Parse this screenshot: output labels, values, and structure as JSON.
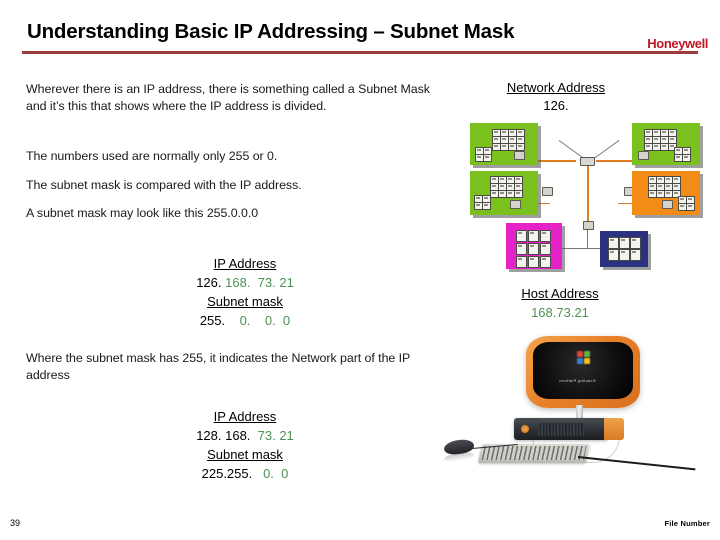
{
  "slide": {
    "title": "Understanding Basic IP Addressing – Subnet Mask",
    "brand": "Honeywell",
    "slide_number": "39",
    "file_number": "File Number",
    "accent_rule_color": "#9e3b3b",
    "brand_color": "#c01826",
    "host_text_color": "#4f9153"
  },
  "body": {
    "paragraph_1": "Wherever there is an IP address, there is something called a Subnet Mask and it’s this that shows where the IP address is divided.",
    "paragraph_2": "The numbers used are normally only 255 or 0.",
    "paragraph_3": "The subnet mask is compared with the IP address.",
    "paragraph_4": "A subnet mask may look like this 255.0.0.0",
    "paragraph_5": "Where the subnet mask has 255, it indicates the Network part of the IP address"
  },
  "ip_block_1": {
    "ip_label": "IP Address",
    "ip_network_part": "126.",
    "ip_host_part": " 168.  73. 21",
    "mask_label": "Subnet mask",
    "mask_network_part": "255.",
    "mask_host_part": "    0.    0.  0"
  },
  "ip_block_2": {
    "ip_label": "IP Address",
    "ip_network_part": "128. 168.",
    "ip_host_part": "  73. 21",
    "mask_label": "Subnet mask",
    "mask_network_part": "225.255.",
    "mask_host_part": "   0.  0"
  },
  "diagram": {
    "network_address_label": "Network Address",
    "network_address_value": "126.",
    "host_address_label": "Host Address",
    "host_address_value": "168.73.21",
    "box_colors": {
      "green": "#7ac11e",
      "orange": "#f28c16",
      "magenta": "#e621c8",
      "navy": "#2b3180"
    },
    "link_color": "#e07b20"
  },
  "computer": {
    "screen_caption": "Exacting Platform"
  }
}
